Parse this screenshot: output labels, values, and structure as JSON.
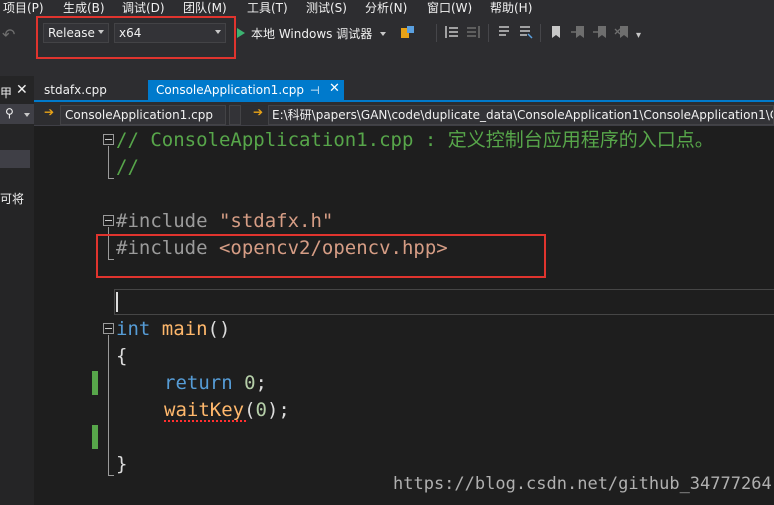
{
  "menubar": {
    "items": [
      {
        "label": "项目(P)"
      },
      {
        "label": "生成(B)"
      },
      {
        "label": "调试(D)"
      },
      {
        "label": "团队(M)"
      },
      {
        "label": "工具(T)"
      },
      {
        "label": "测试(S)"
      },
      {
        "label": "分析(N)"
      },
      {
        "label": "窗口(W)"
      },
      {
        "label": "帮助(H)"
      }
    ]
  },
  "toolbar": {
    "configuration": "Release",
    "platform": "x64",
    "debugger": "本地 Windows 调试器",
    "highlight_color": "#e0342e"
  },
  "left_panel": {
    "title": "甲",
    "text": "可将"
  },
  "tabs": [
    {
      "label": "stdafx.cpp",
      "active": false
    },
    {
      "label": "ConsoleApplication1.cpp",
      "active": true
    }
  ],
  "navbar": {
    "scope": "ConsoleApplication1.cpp",
    "path": "E:\\科研\\papers\\GAN\\code\\duplicate_data\\ConsoleApplication1\\ConsoleApplication1\\C"
  },
  "code": {
    "line1": {
      "text": "// ConsoleApplication1.cpp : 定义控制台应用程序的入口点。"
    },
    "line2": {
      "text": "//"
    },
    "line4": {
      "directive": "#include",
      "arg": "\"stdafx.h\""
    },
    "line5": {
      "directive": "#include",
      "arg": "<opencv2/opencv.hpp>"
    },
    "line7": {
      "type": "int",
      "name": "main",
      "rest": "()"
    },
    "line8": {
      "text": "{"
    },
    "line9": {
      "keyword": "return",
      "value": "0",
      "end": ";"
    },
    "line10": {
      "func": "waitKey",
      "open": "(",
      "arg": "0",
      "close": ");"
    },
    "line12": {
      "text": "}"
    }
  },
  "watermark": "https://blog.csdn.net/github_34777264",
  "colors": {
    "background": "#1e1e1e",
    "accent": "#007acc",
    "comment": "#57a64a",
    "keyword": "#569cd6",
    "string": "#d69d85",
    "function": "#ffb86c"
  }
}
